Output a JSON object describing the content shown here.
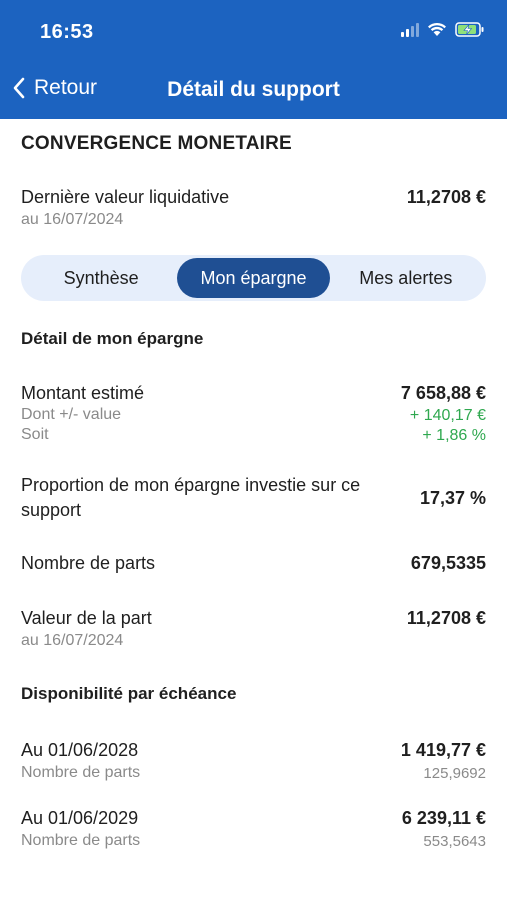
{
  "status": {
    "time": "16:53"
  },
  "nav": {
    "back_label": "Retour",
    "title": "Détail du support"
  },
  "fund": {
    "name": "CONVERGENCE MONETAIRE",
    "vl_label": "Dernière valeur liquidative",
    "vl_date": "au 16/07/2024",
    "vl_value": "11,2708 €"
  },
  "tabs": [
    {
      "label": "Synthèse",
      "active": false
    },
    {
      "label": "Mon épargne",
      "active": true
    },
    {
      "label": "Mes alertes",
      "active": false
    }
  ],
  "detail": {
    "section_title": "Détail de mon épargne",
    "montant_label": "Montant estimé",
    "montant_value": "7 658,88 €",
    "plus_value_label": "Dont +/- value",
    "plus_value_value": "+ 140,17 €",
    "soit_label": "Soit",
    "soit_value": "+ 1,86 %",
    "proportion_label": "Proportion de mon épargne investie sur ce support",
    "proportion_value": "17,37 %",
    "parts_label": "Nombre de parts",
    "parts_value": "679,5335",
    "valeur_part_label": "Valeur de la part",
    "valeur_part_date": "au 16/07/2024",
    "valeur_part_value": "11,2708 €"
  },
  "disponibilite": {
    "section_title": "Disponibilité par échéance",
    "rows": [
      {
        "date": "Au 01/06/2028",
        "sub_label": "Nombre de parts",
        "amount": "1 419,77 €",
        "parts": "125,9692"
      },
      {
        "date": "Au 01/06/2029",
        "sub_label": "Nombre de parts",
        "amount": "6 239,11 €",
        "parts": "553,5643"
      }
    ]
  },
  "colors": {
    "header": "#1c63c0",
    "tab_active": "#1f4f93",
    "tab_bg": "#e6eefb",
    "positive": "#2fa84f"
  }
}
